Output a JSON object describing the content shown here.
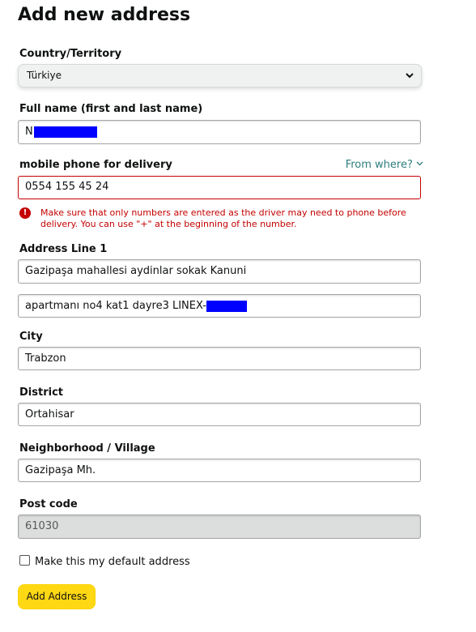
{
  "title": "Add new address",
  "country": {
    "label": "Country/Territory",
    "value": "Türkiye"
  },
  "full_name": {
    "label": "Full name (first and last name)",
    "value": "N"
  },
  "phone": {
    "label": "mobile phone for delivery",
    "help_link": "From where?",
    "value": "0554 155 45 24",
    "error": "Make sure that only numbers are entered as the driver may need to phone before delivery. You can use \"+\" at the beginning of the number."
  },
  "address": {
    "label": "Address Line 1",
    "line1": "Gazipaşa mahallesi aydinlar sokak Kanuni",
    "line2": "apartmanı no4 kat1 dayre3 LINEX-"
  },
  "city": {
    "label": "City",
    "value": "Trabzon"
  },
  "district": {
    "label": "District",
    "value": "Ortahisar"
  },
  "neighborhood": {
    "label": "Neighborhood / Village",
    "value": "Gazipaşa Mh."
  },
  "post_code": {
    "label": "Post code",
    "value": "61030"
  },
  "default_checkbox": {
    "label": "Make this my default address",
    "checked": false
  },
  "submit": {
    "label": "Add Address"
  },
  "colors": {
    "button": "#ffd814",
    "error": "#c40000",
    "link": "#2e7d7d",
    "redaction": "#0000ff"
  }
}
